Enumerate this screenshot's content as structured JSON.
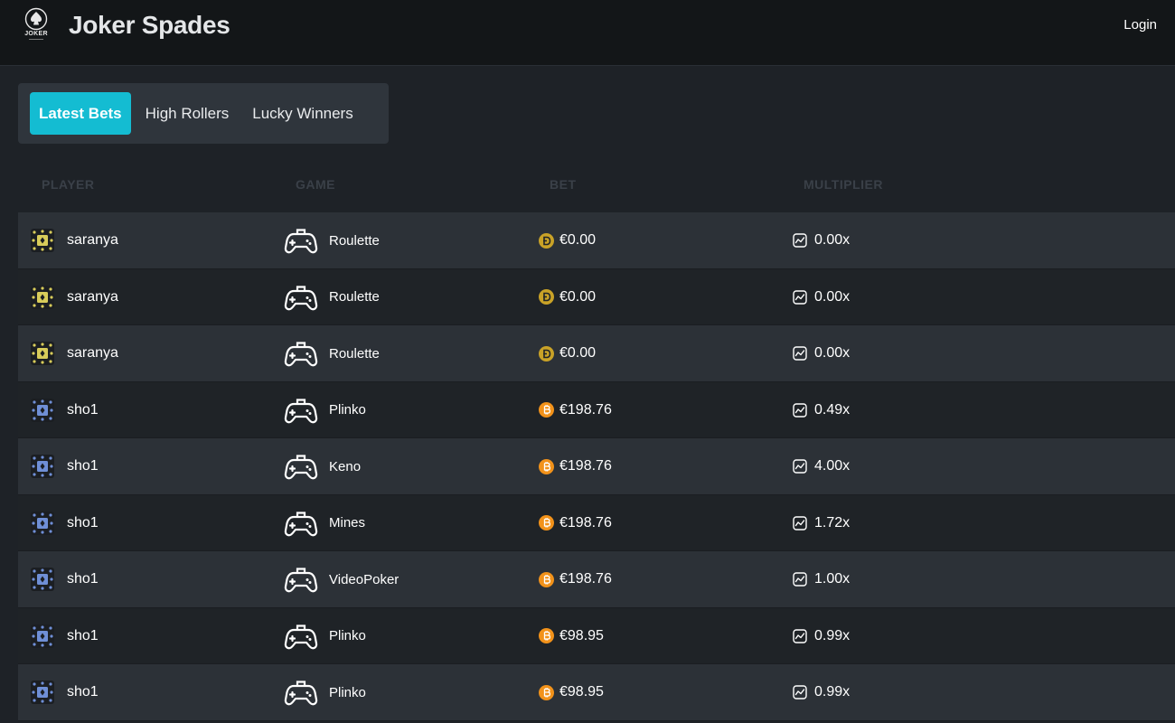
{
  "header": {
    "logo_text": "JOKER",
    "brand": "Joker Spades",
    "login_label": "Login"
  },
  "tabs": [
    {
      "label": "Latest Bets",
      "active": true
    },
    {
      "label": "High Rollers",
      "active": false
    },
    {
      "label": "Lucky Winners",
      "active": false
    }
  ],
  "table": {
    "columns": [
      "PLAYER",
      "GAME",
      "BET",
      "MULTIPLIER"
    ],
    "rows": [
      {
        "player": "saranya",
        "avatar": "yellow",
        "game": "Roulette",
        "coin": "doge",
        "bet": "€0.00",
        "multiplier": "0.00x"
      },
      {
        "player": "saranya",
        "avatar": "yellow",
        "game": "Roulette",
        "coin": "doge",
        "bet": "€0.00",
        "multiplier": "0.00x"
      },
      {
        "player": "saranya",
        "avatar": "yellow",
        "game": "Roulette",
        "coin": "doge",
        "bet": "€0.00",
        "multiplier": "0.00x"
      },
      {
        "player": "sho1",
        "avatar": "blue",
        "game": "Plinko",
        "coin": "btc",
        "bet": "€198.76",
        "multiplier": "0.49x"
      },
      {
        "player": "sho1",
        "avatar": "blue",
        "game": "Keno",
        "coin": "btc",
        "bet": "€198.76",
        "multiplier": "4.00x"
      },
      {
        "player": "sho1",
        "avatar": "blue",
        "game": "Mines",
        "coin": "btc",
        "bet": "€198.76",
        "multiplier": "1.72x"
      },
      {
        "player": "sho1",
        "avatar": "blue",
        "game": "VideoPoker",
        "coin": "btc",
        "bet": "€198.76",
        "multiplier": "1.00x"
      },
      {
        "player": "sho1",
        "avatar": "blue",
        "game": "Plinko",
        "coin": "btc",
        "bet": "€98.95",
        "multiplier": "0.99x"
      },
      {
        "player": "sho1",
        "avatar": "blue",
        "game": "Plinko",
        "coin": "btc",
        "bet": "€98.95",
        "multiplier": "0.99x"
      }
    ]
  },
  "icons": {
    "logo": "joker-spade-icon",
    "game": "gamepad-icon",
    "doge_coin": "dogecoin-icon",
    "btc_coin": "bitcoin-icon",
    "multiplier": "trend-chart-icon"
  },
  "colors": {
    "accent": "#14bcd2",
    "avatar_yellow": "#d8cc5a",
    "avatar_blue": "#6f8fd6",
    "doge": "#c9a227",
    "btc": "#f2921a"
  }
}
